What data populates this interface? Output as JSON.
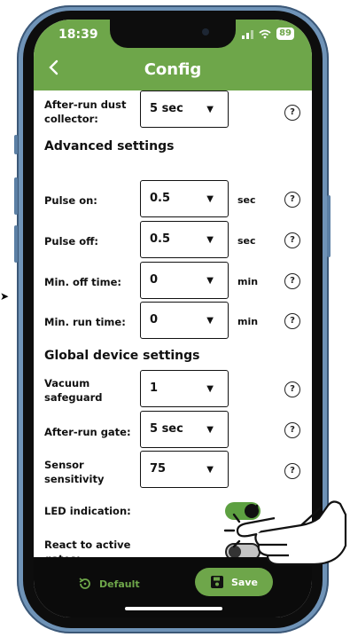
{
  "status_bar": {
    "time": "18:39",
    "battery": "89"
  },
  "header": {
    "title": "Config"
  },
  "rows": {
    "after_run_dust_collector": {
      "label": "After-run dust collector:",
      "value": "5 sec"
    },
    "pulse_on": {
      "label": "Pulse on:",
      "value": "0.5",
      "unit": "sec"
    },
    "pulse_off": {
      "label": "Pulse off:",
      "value": "0.5",
      "unit": "sec"
    },
    "min_off_time": {
      "label": "Min. off time:",
      "value": "0",
      "unit": "min"
    },
    "min_run_time": {
      "label": "Min. run time:",
      "value": "0",
      "unit": "min"
    },
    "vacuum_safeguard": {
      "label": "Vacuum safeguard",
      "value": "1"
    },
    "after_run_gate": {
      "label": "After-run gate:",
      "value": "5 sec"
    },
    "sensor_sensitivity": {
      "label": "Sensor sensitivity",
      "value": "75"
    },
    "led_indication": {
      "label": "LED indication:",
      "enabled": true
    },
    "react_to_active_gates": {
      "label": "React to active gates:",
      "enabled": false
    }
  },
  "sections": {
    "advanced": "Advanced settings",
    "global": "Global device settings"
  },
  "footer": {
    "default_label": "Default",
    "save_label": "Save"
  },
  "colors": {
    "accent": "#6ea64a",
    "footer_bg": "#0b0b0b"
  },
  "icons": [
    "back-chevron-icon",
    "help-icon",
    "caret-down-icon",
    "restore-icon",
    "save-disk-icon",
    "pointing-hand-icon",
    "signal-icon",
    "wifi-icon",
    "battery-icon"
  ]
}
